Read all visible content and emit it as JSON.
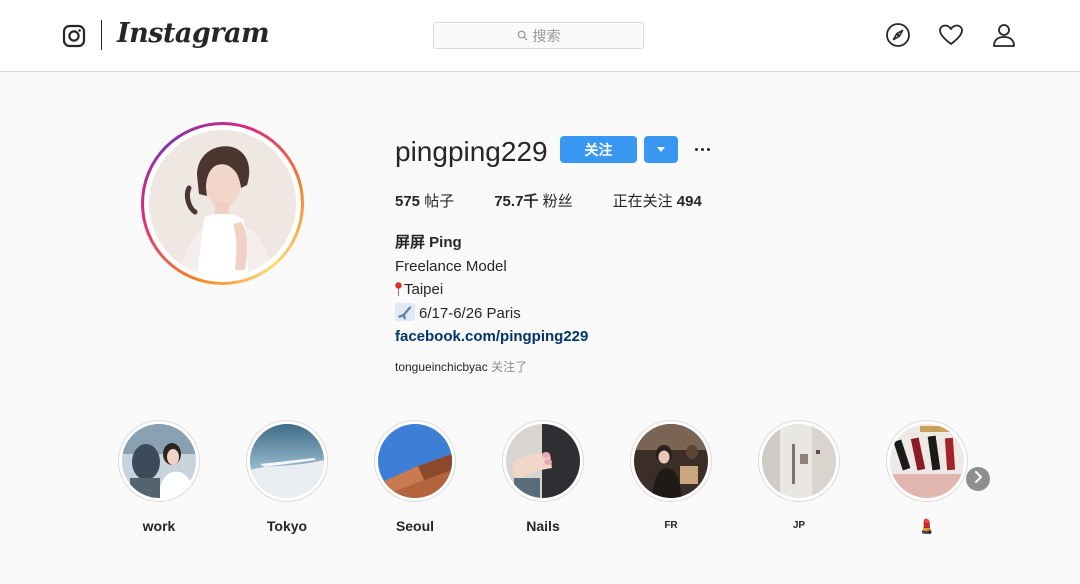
{
  "nav": {
    "brand": "Instagram",
    "search_placeholder": "搜索"
  },
  "profile": {
    "username": "pingping229",
    "follow_label": "关注",
    "stats": {
      "posts_value": "575",
      "posts_label": "帖子",
      "followers_value": "75.7千",
      "followers_label": "粉丝",
      "following_label": "正在关注",
      "following_value": "494"
    },
    "bio": {
      "full_name": "屏屏 Ping",
      "line1": "Freelance Model",
      "line2": "Taipei",
      "line3": "6/17-6/26 Paris",
      "link": "facebook.com/pingping229"
    },
    "followed_by_user": "tongueinchicbyac",
    "followed_by_suffix": "关注了"
  },
  "highlights": [
    {
      "label": "work"
    },
    {
      "label": "Tokyo"
    },
    {
      "label": "Seoul"
    },
    {
      "label": "Nails"
    },
    {
      "label": "FR"
    },
    {
      "label": "JP"
    },
    {
      "label": "💄"
    }
  ],
  "icons": {
    "logo": "instagram-glyph-icon",
    "explore": "compass-icon",
    "activity": "heart-icon",
    "profile": "user-icon",
    "next": "chevron-right-icon"
  },
  "colors": {
    "accent": "#3897f0",
    "link": "#003569",
    "background": "#fafafa"
  }
}
